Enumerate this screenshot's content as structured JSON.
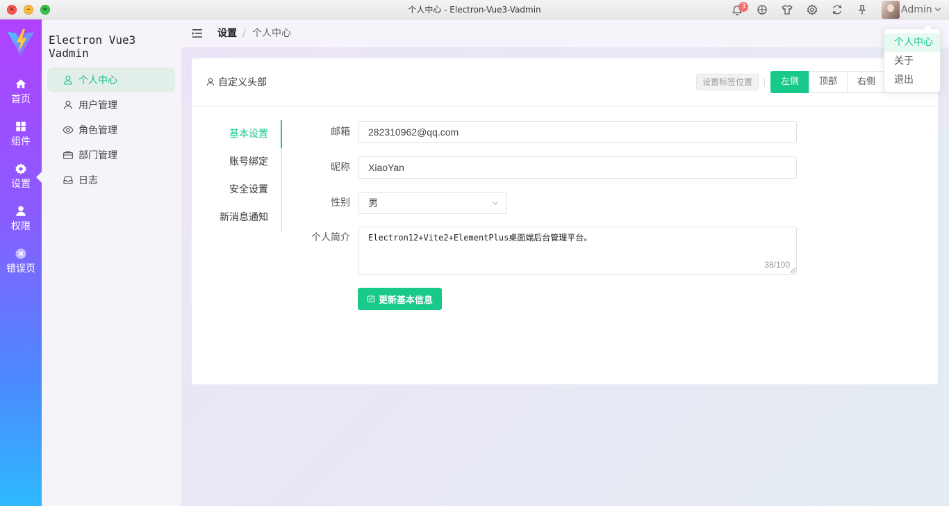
{
  "window": {
    "title": "个人中心 - Electron-Vue3-Vadmin",
    "notification_count": "3",
    "user_name": "Admin"
  },
  "rail": {
    "items": [
      {
        "label": "首页",
        "icon": "home-icon"
      },
      {
        "label": "组件",
        "icon": "grid-icon"
      },
      {
        "label": "设置",
        "icon": "gear-icon"
      },
      {
        "label": "权限",
        "icon": "user-icon"
      },
      {
        "label": "错误页",
        "icon": "close-circle-icon"
      }
    ],
    "active_index": 2
  },
  "sidebar": {
    "app_name": "Electron Vue3 Vadmin",
    "items": [
      {
        "label": "个人中心",
        "icon": "user-outline-icon"
      },
      {
        "label": "用户管理",
        "icon": "user-outline-icon"
      },
      {
        "label": "角色管理",
        "icon": "eye-icon"
      },
      {
        "label": "部门管理",
        "icon": "briefcase-icon"
      },
      {
        "label": "日志",
        "icon": "inbox-icon"
      }
    ],
    "active_index": 0
  },
  "breadcrumb": {
    "level1": "设置",
    "separator": "/",
    "level2": "个人中心"
  },
  "card": {
    "header_title": "自定义头部",
    "tag_position_label": "设置标签位置",
    "positions": [
      "左侧",
      "顶部",
      "右侧"
    ],
    "selected_position": "左侧"
  },
  "tabs": {
    "items": [
      "基本设置",
      "账号绑定",
      "安全设置",
      "新消息通知"
    ],
    "active_index": 0
  },
  "form": {
    "email_label": "邮箱",
    "email_value": "282310962@qq.com",
    "nickname_label": "昵称",
    "nickname_value": "XiaoYan",
    "gender_label": "性别",
    "gender_value": "男",
    "bio_label": "个人简介",
    "bio_value": "Electron12+Vite2+ElementPlus桌面端后台管理平台。",
    "bio_counter": "38/100",
    "submit_label": "更新基本信息"
  },
  "user_menu": {
    "items": [
      "个人中心",
      "关于",
      "退出"
    ],
    "active_index": 0
  },
  "colors": {
    "accent": "#18c98a",
    "badge": "#f56c6c"
  }
}
